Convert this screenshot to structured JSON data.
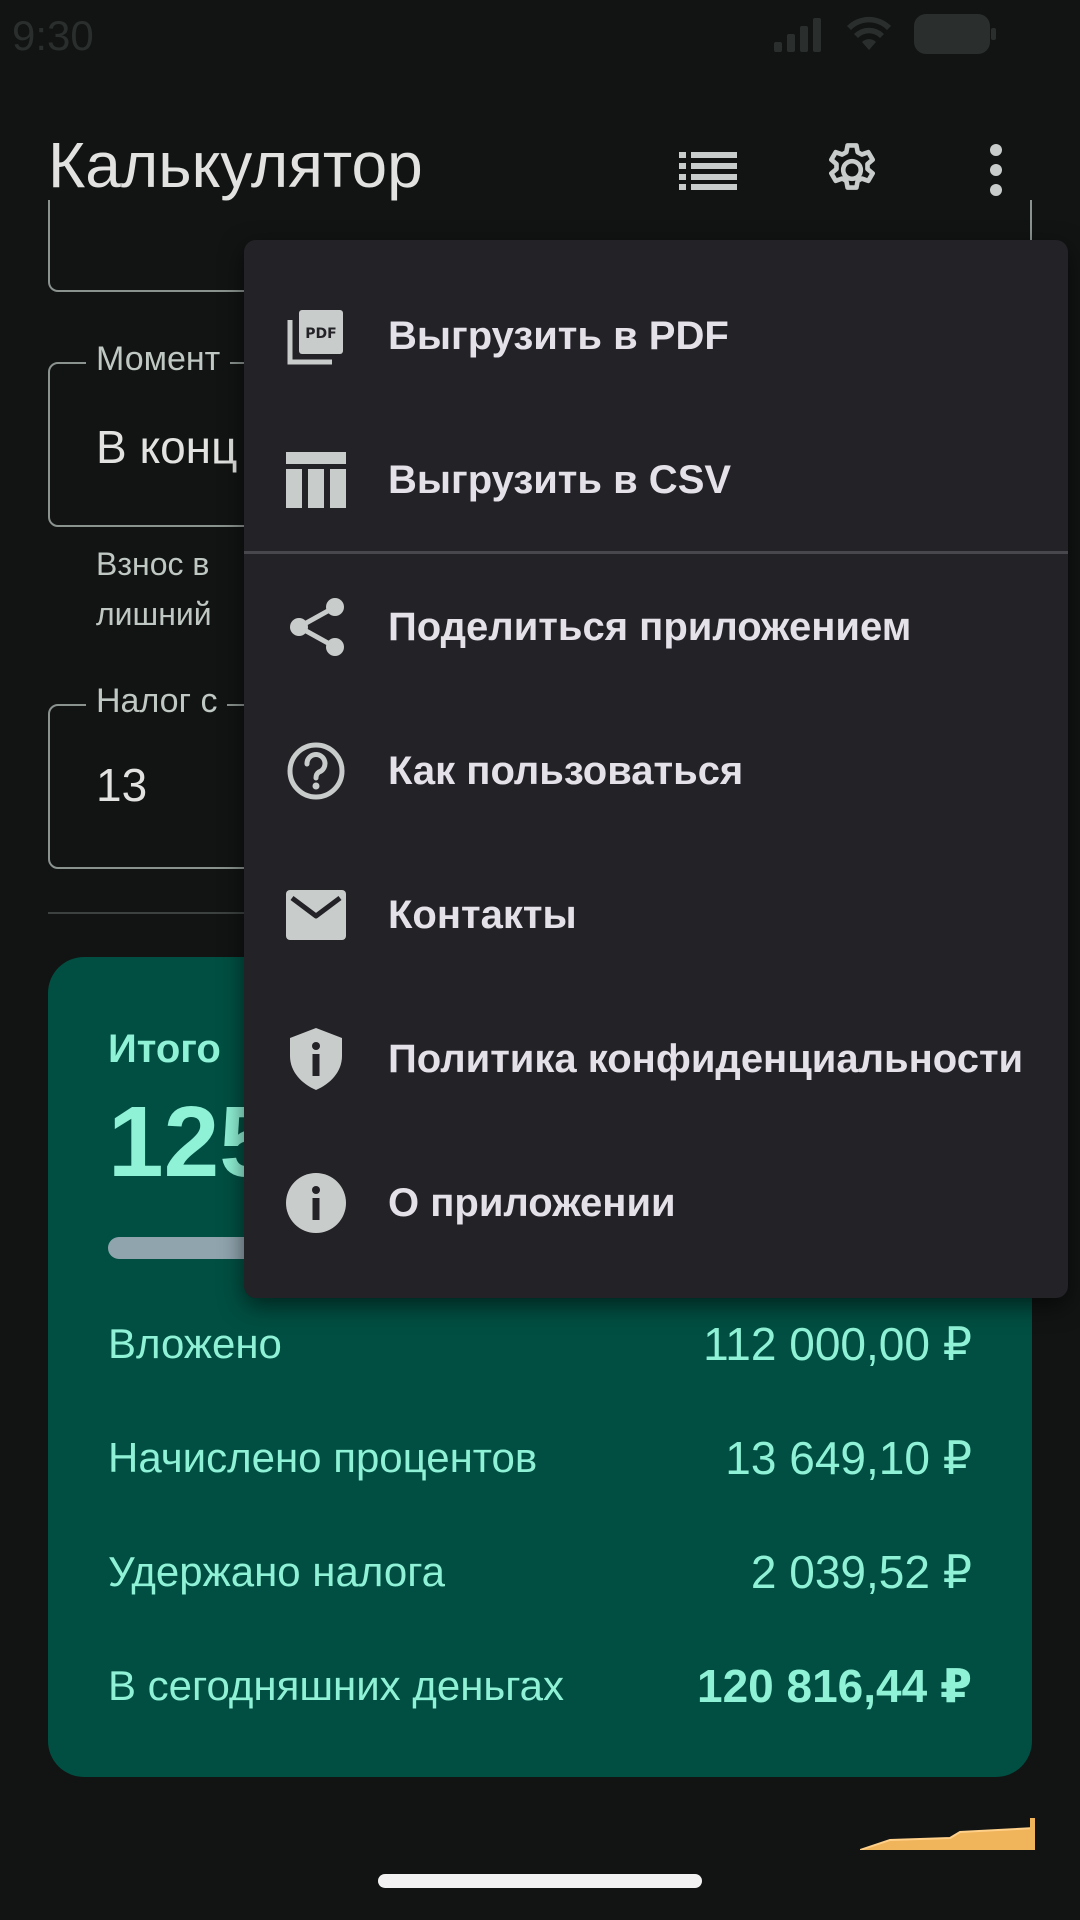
{
  "status_bar": {
    "time": "9:30"
  },
  "app_bar": {
    "title": "Калькулятор",
    "icons": [
      "list-icon",
      "gear-icon",
      "more-vert-icon"
    ]
  },
  "form": {
    "moment_label": "Момент",
    "moment_value": "В конц",
    "moment_helper_line1": "Взнос в",
    "moment_helper_line2": "лишний",
    "tax_label": "Налог с",
    "tax_value": "13"
  },
  "results": {
    "total_label": "Итого",
    "total_value": "125",
    "rows": [
      {
        "label": "Вложено",
        "value": "112 000,00 ₽"
      },
      {
        "label": "Начислено процентов",
        "value": "13 649,10 ₽"
      },
      {
        "label": "Удержано налога",
        "value": "2 039,52 ₽"
      },
      {
        "label": "В сегодняшних деньгах",
        "value": "120 816,44 ₽"
      }
    ]
  },
  "menu": {
    "items": [
      {
        "label": "Выгрузить в PDF",
        "icon": "pdf-icon"
      },
      {
        "label": "Выгрузить в CSV",
        "icon": "table-icon"
      },
      {
        "label": "Поделиться приложением",
        "icon": "share-icon"
      },
      {
        "label": "Как пользоваться",
        "icon": "help-icon"
      },
      {
        "label": "Контакты",
        "icon": "mail-icon"
      },
      {
        "label": "Политика конфиденциальности",
        "icon": "shield-info-icon"
      },
      {
        "label": "О приложении",
        "icon": "info-icon"
      }
    ]
  },
  "colors": {
    "background": "#111413",
    "card": "#004f42",
    "card_text": "#8ff1d5",
    "menu_background": "#232227",
    "chart_accent": "#f0b45a"
  }
}
